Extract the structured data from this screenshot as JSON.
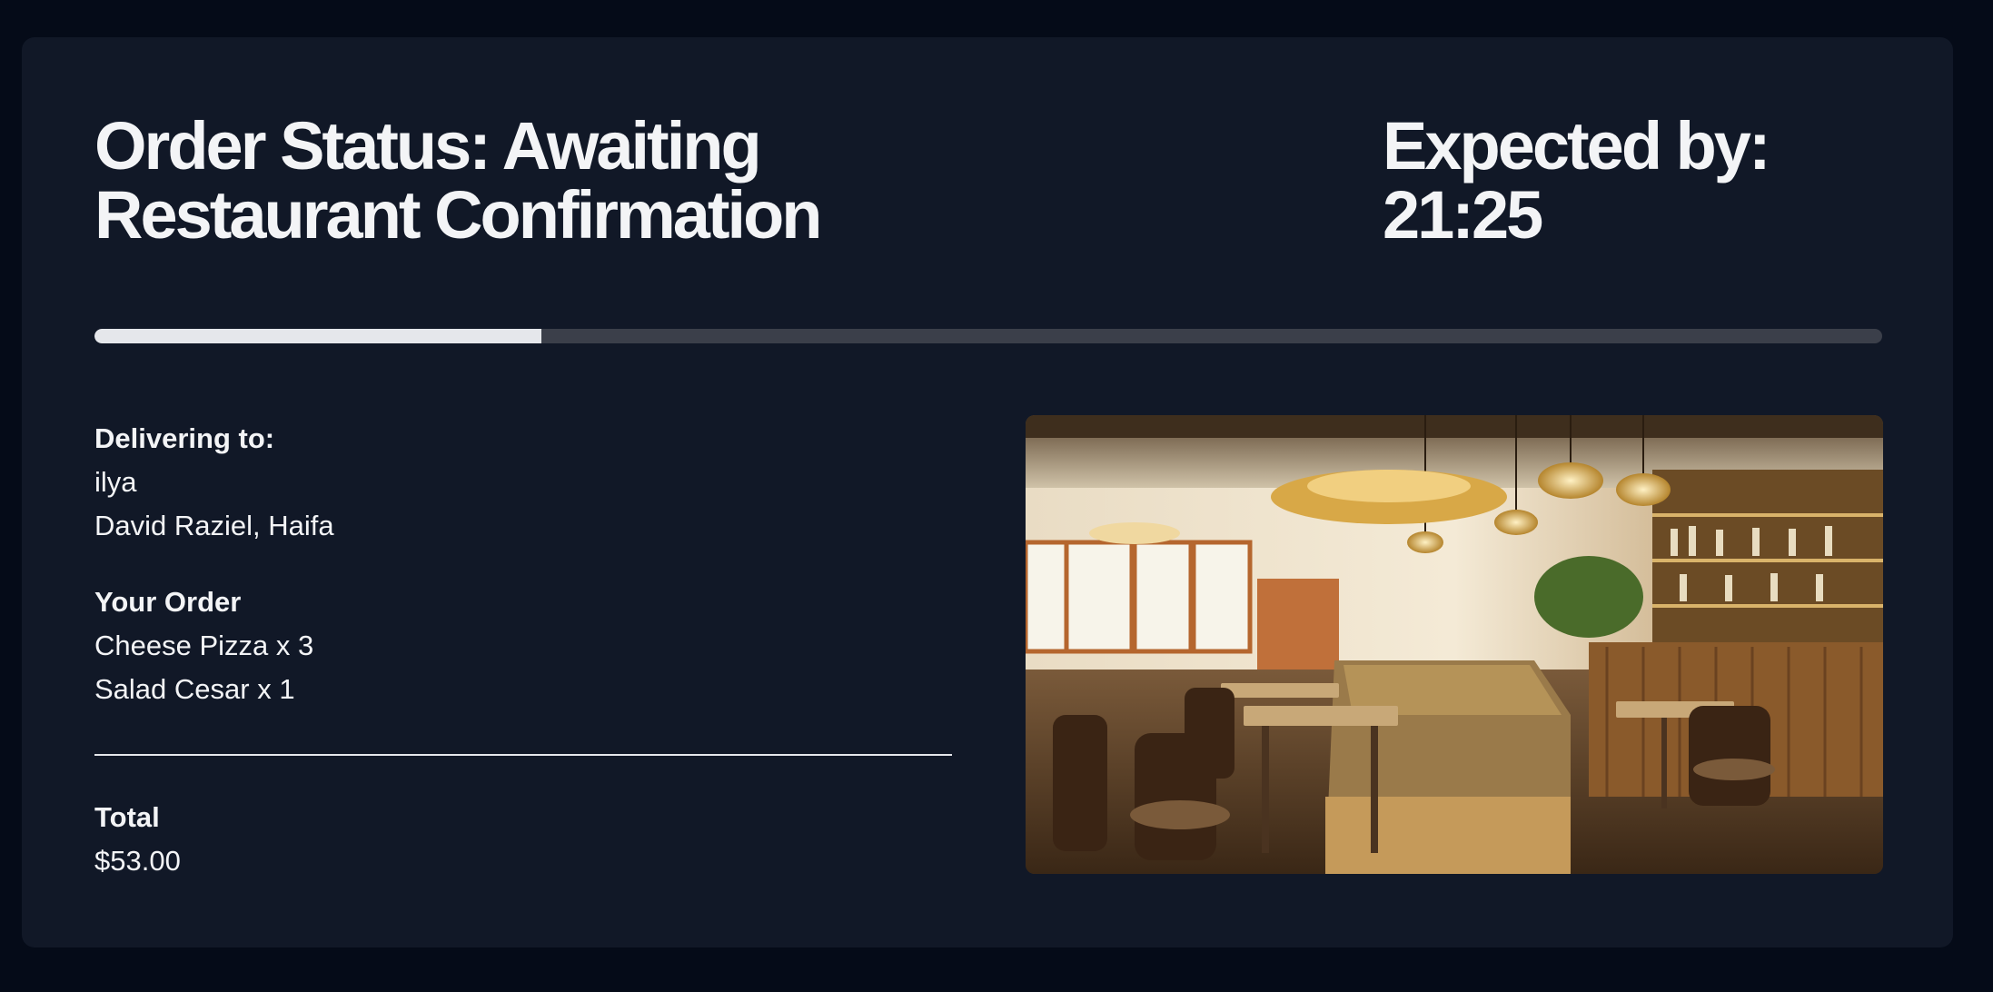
{
  "order": {
    "status_title": "Order Status: Awaiting Restaurant Confirmation",
    "expected_label": "Expected by: 21:25",
    "progress_fraction": 0.25
  },
  "delivery": {
    "label": "Delivering to:",
    "name": "ilya",
    "address": "David Raziel, Haifa"
  },
  "items_section": {
    "label": "Your Order",
    "items": [
      "Cheese Pizza x 3",
      "Salad Cesar x 1"
    ]
  },
  "total": {
    "label": "Total",
    "value": "$53.00"
  },
  "image": {
    "subject": "restaurant-interior-photo"
  },
  "colors": {
    "page_bg": "#050b18",
    "card_bg": "#111827",
    "text": "#f3f4f6",
    "progress_fill": "#e5e7eb",
    "progress_track": "#3b3f4a"
  }
}
